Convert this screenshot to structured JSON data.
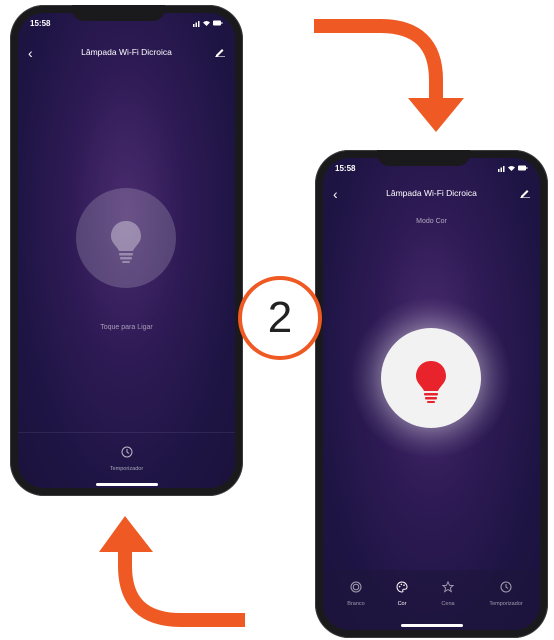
{
  "step_number": "2",
  "accent_color": "#ef5a24",
  "left_phone": {
    "status_time": "15:58",
    "status_icons": "signal-wifi-battery",
    "title": "Lâmpada Wi-Fi Dicroica",
    "tap_label": "Toque para Ligar",
    "bottom_tab": "Temporizador",
    "state": "off"
  },
  "right_phone": {
    "status_time": "15:58",
    "status_icons": "signal-wifi-battery",
    "title": "Lâmpada Wi-Fi Dicroica",
    "mode_label": "Modo Cor",
    "bulb_color": "#e8232b",
    "state": "on",
    "tabs": [
      {
        "label": "Branco",
        "icon": "white-mode-icon",
        "active": false
      },
      {
        "label": "Cor",
        "icon": "palette-icon",
        "active": true
      },
      {
        "label": "Cena",
        "icon": "star-icon",
        "active": false
      },
      {
        "label": "Temporizador",
        "icon": "clock-icon",
        "active": false
      }
    ]
  }
}
